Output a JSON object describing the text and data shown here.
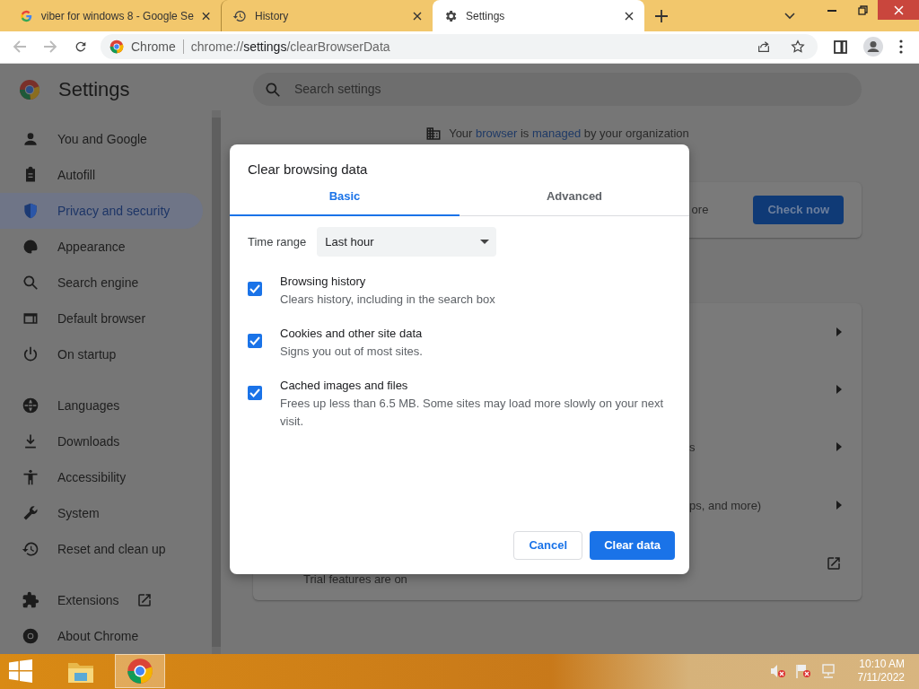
{
  "browser": {
    "tabs": [
      {
        "title": "viber for windows 8 - Google Se",
        "selected": false
      },
      {
        "title": "History",
        "selected": false
      },
      {
        "title": "Settings",
        "selected": true
      }
    ],
    "address": {
      "label": "Chrome",
      "prefix": "chrome://",
      "host": "settings",
      "path": "/clearBrowserData"
    }
  },
  "settings": {
    "title": "Settings",
    "search": {
      "placeholder": "Search settings"
    },
    "nav_groups": [
      {
        "items": [
          {
            "label": "You and Google",
            "selected": false,
            "external": false
          },
          {
            "label": "Autofill",
            "selected": false,
            "external": false
          },
          {
            "label": "Privacy and security",
            "selected": true,
            "external": false
          },
          {
            "label": "Appearance",
            "selected": false,
            "external": false
          },
          {
            "label": "Search engine",
            "selected": false,
            "external": false
          },
          {
            "label": "Default browser",
            "selected": false,
            "external": false
          },
          {
            "label": "On startup",
            "selected": false,
            "external": false
          }
        ]
      },
      {
        "items": [
          {
            "label": "Languages",
            "selected": false,
            "external": false
          },
          {
            "label": "Downloads",
            "selected": false,
            "external": false
          },
          {
            "label": "Accessibility",
            "selected": false,
            "external": false
          },
          {
            "label": "System",
            "selected": false,
            "external": false
          },
          {
            "label": "Reset and clean up",
            "selected": false,
            "external": false
          }
        ]
      },
      {
        "items": [
          {
            "label": "Extensions",
            "selected": false,
            "external": true
          },
          {
            "label": "About Chrome",
            "selected": false,
            "external": false
          }
        ]
      }
    ],
    "managed_notice": [
      {
        "text": "Your ",
        "link": false
      },
      {
        "text": "browser",
        "link": true
      },
      {
        "text": " is ",
        "link": false
      },
      {
        "text": "managed",
        "link": true
      },
      {
        "text": " by your organization",
        "link": false
      }
    ],
    "safety_card": {
      "text": "ore",
      "button": "Check now"
    },
    "rows": [
      {
        "kind": "arrow"
      },
      {
        "kind": "arrow"
      },
      {
        "text": "s",
        "kind": "arrow"
      },
      {
        "text": "ps, and more)",
        "kind": "arrow"
      },
      {
        "text": "Trial features are on",
        "kind": "external"
      }
    ]
  },
  "dialog": {
    "title": "Clear browsing data",
    "tabs": [
      {
        "label": "Basic",
        "selected": true
      },
      {
        "label": "Advanced",
        "selected": false
      }
    ],
    "time_range": {
      "label": "Time range",
      "value": "Last hour"
    },
    "options": [
      {
        "title": "Browsing history",
        "description": "Clears history, including in the search box",
        "checked": true
      },
      {
        "title": "Cookies and other site data",
        "description": "Signs you out of most sites.",
        "checked": true
      },
      {
        "title": "Cached images and files",
        "description": "Frees up less than 6.5 MB. Some sites may load more slowly on your next visit.",
        "checked": true
      }
    ],
    "cancel": "Cancel",
    "confirm": "Clear data"
  },
  "taskbar": {
    "apps": [
      {
        "selected": false
      },
      {
        "selected": true
      }
    ],
    "time": "10:10 AM",
    "date": "7/11/2022"
  }
}
